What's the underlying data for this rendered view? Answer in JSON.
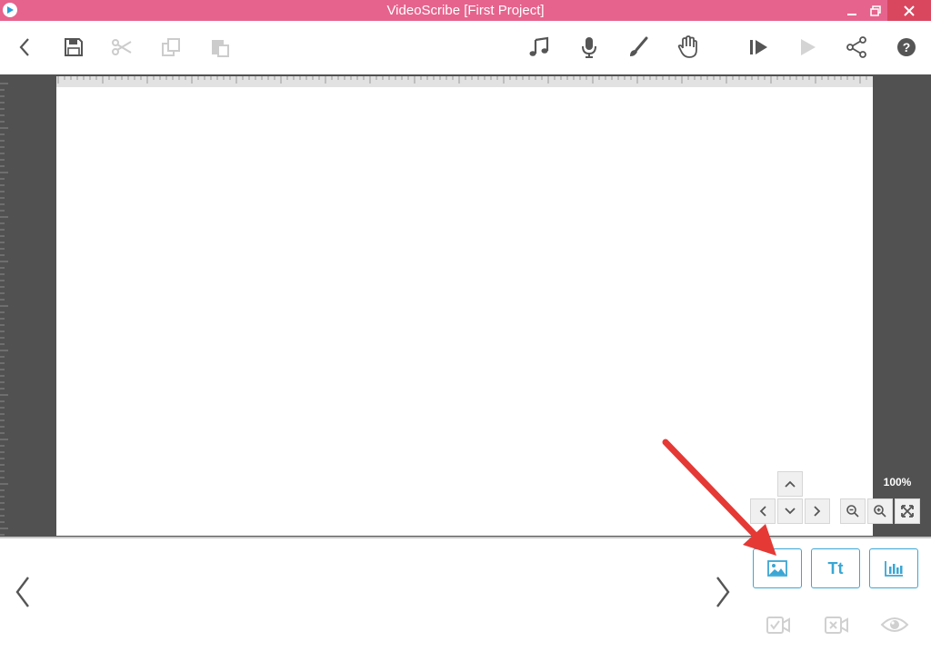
{
  "window": {
    "title": "VideoScribe [First Project]"
  },
  "toolbar": {
    "left_icons": [
      "back-icon",
      "save-icon",
      "cut-icon",
      "copy-icon",
      "paste-icon"
    ],
    "right_icons": [
      "music-icon",
      "microphone-icon",
      "brush-icon",
      "hand-icon",
      "play-from-icon",
      "play-icon",
      "share-icon",
      "help-icon"
    ]
  },
  "canvas": {
    "zoom": "100%"
  },
  "bottom_bar": {
    "add_text_label": "Tt",
    "colors": {
      "accent": "#3aa6d4",
      "title_bar": "#e6638d",
      "annotation_arrow": "#e53935"
    }
  }
}
